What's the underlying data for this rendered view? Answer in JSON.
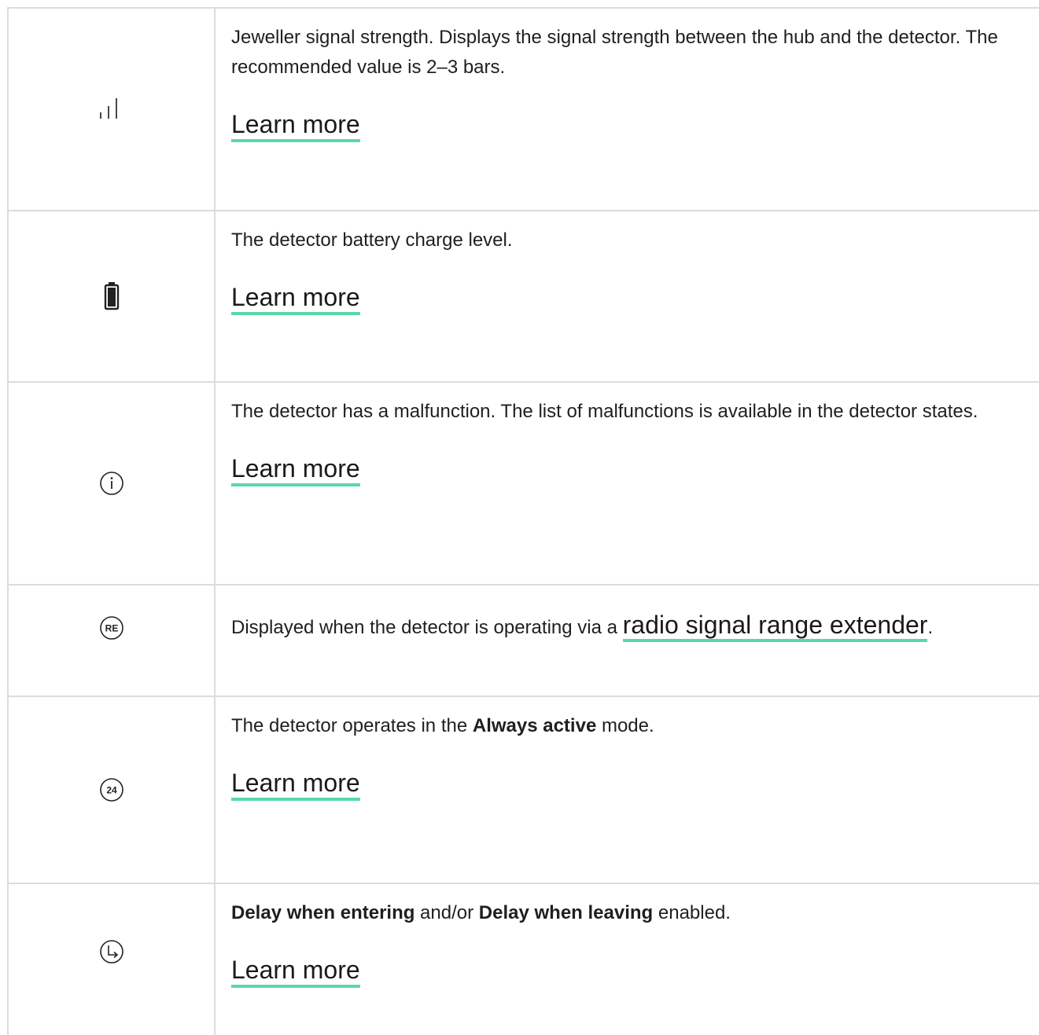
{
  "rows": [
    {
      "icon": "signal-bars-icon",
      "description": "Jeweller signal strength. Displays the signal strength between the hub and the detector. The recommended value is 2–3 bars.",
      "link": "Learn more"
    },
    {
      "icon": "battery-icon",
      "description": "The detector battery charge level.",
      "link": "Learn more"
    },
    {
      "icon": "info-icon",
      "description": "The detector has a malfunction. The list of malfunctions is available in the detector states.",
      "link": "Learn more"
    },
    {
      "icon": "re-icon",
      "icon_text": "RE",
      "description_prefix": "Displayed when the detector is operating via a ",
      "link": "radio signal range extender",
      "description_suffix": "."
    },
    {
      "icon": "always-active-24-icon",
      "icon_text": "24",
      "description_prefix": "The detector operates in the ",
      "bold": "Always active",
      "description_suffix": " mode.",
      "link": "Learn more"
    },
    {
      "icon": "delay-clock-icon",
      "bold_1": "Delay when entering",
      "middle": " and/or ",
      "bold_2": "Delay when leaving",
      "description_suffix": " enabled.",
      "link": "Learn more"
    }
  ],
  "colors": {
    "border": "#dcdcdc",
    "link_underline": "#5ad8a6",
    "text": "#1f1f1f"
  }
}
